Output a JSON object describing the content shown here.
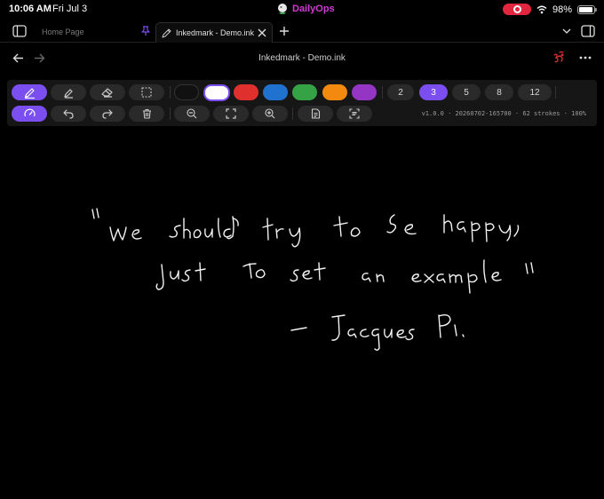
{
  "status_bar": {
    "time": "10:06 AM",
    "date": "Fri Jul 3",
    "app_name": "DailyOps",
    "battery": "98%"
  },
  "tabs": [
    {
      "label": "Home Page",
      "active": false,
      "icon": "pin-icon"
    },
    {
      "label": "Inkedmark - Demo.ink",
      "active": true,
      "icon": "pen-icon"
    }
  ],
  "header": {
    "title": "Inkedmark - Demo.ink"
  },
  "toolbar": {
    "tools_row1": [
      "pen-icon",
      "highlighter-icon",
      "eraser-icon",
      "lasso-select-icon"
    ],
    "tools_row2": [
      "pressure-gauge-icon",
      "undo-icon",
      "redo-icon",
      "trash-icon"
    ],
    "view_tools": [
      "zoom-out-icon",
      "fit-screen-icon",
      "zoom-in-icon",
      "document-icon",
      "scan-text-icon"
    ],
    "colors": [
      "#111111",
      "#ffffff",
      "#e0302e",
      "#1f72cf",
      "#35a245",
      "#f4890f",
      "#9435c3"
    ],
    "selected_color": "#ffffff",
    "widths": [
      "2",
      "3",
      "5",
      "8",
      "12"
    ],
    "selected_width": "3",
    "meta": "v1.0.0 · 20260702-165700 · 62 strokes · 100%"
  }
}
